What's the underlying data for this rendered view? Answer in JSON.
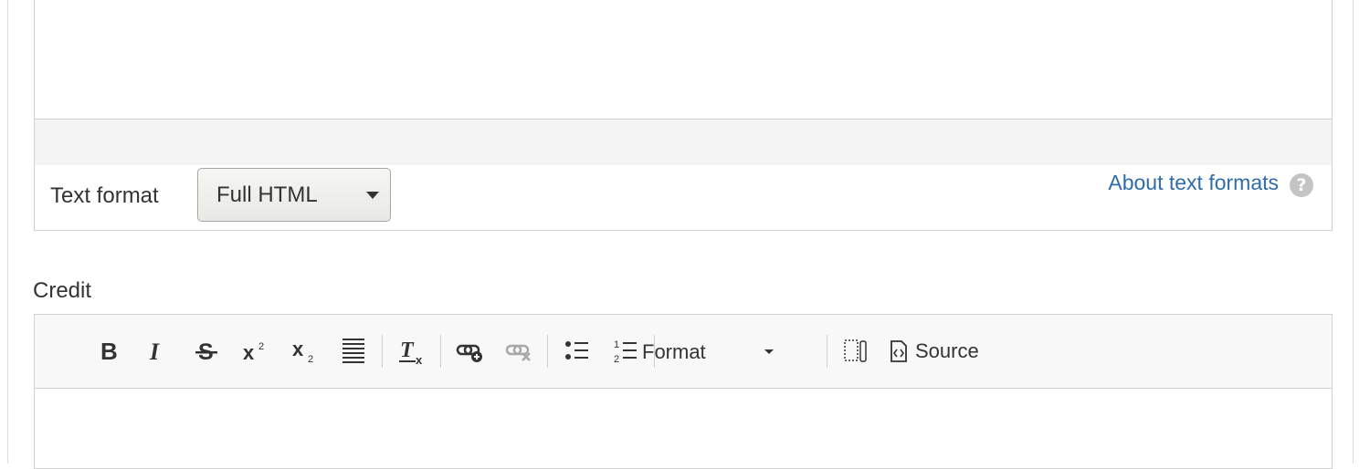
{
  "body_field": {
    "text_format": {
      "label": "Text format",
      "selected": "Full HTML",
      "about_link": "About text formats",
      "help_icon": "?"
    }
  },
  "credit_field": {
    "label": "Credit",
    "toolbar": {
      "bold": "bold-icon",
      "italic": "italic-icon",
      "strike": "strikethrough-icon",
      "superscript": "superscript-icon",
      "subscript": "subscript-icon",
      "justify": "justify-icon",
      "remove_format": "remove-format-icon",
      "link": "link-icon",
      "unlink": "unlink-icon",
      "bulleted_list": "bulleted-list-icon",
      "numbered_list": "numbered-list-icon",
      "format_label": "Format",
      "show_blocks": "show-blocks-icon",
      "source_label": "Source"
    }
  },
  "colors": {
    "link": "#2f6ca8",
    "border": "#d1d1d1",
    "toolbar_bg": "#f8f8f8",
    "bar_bg": "#f3f3f3"
  }
}
